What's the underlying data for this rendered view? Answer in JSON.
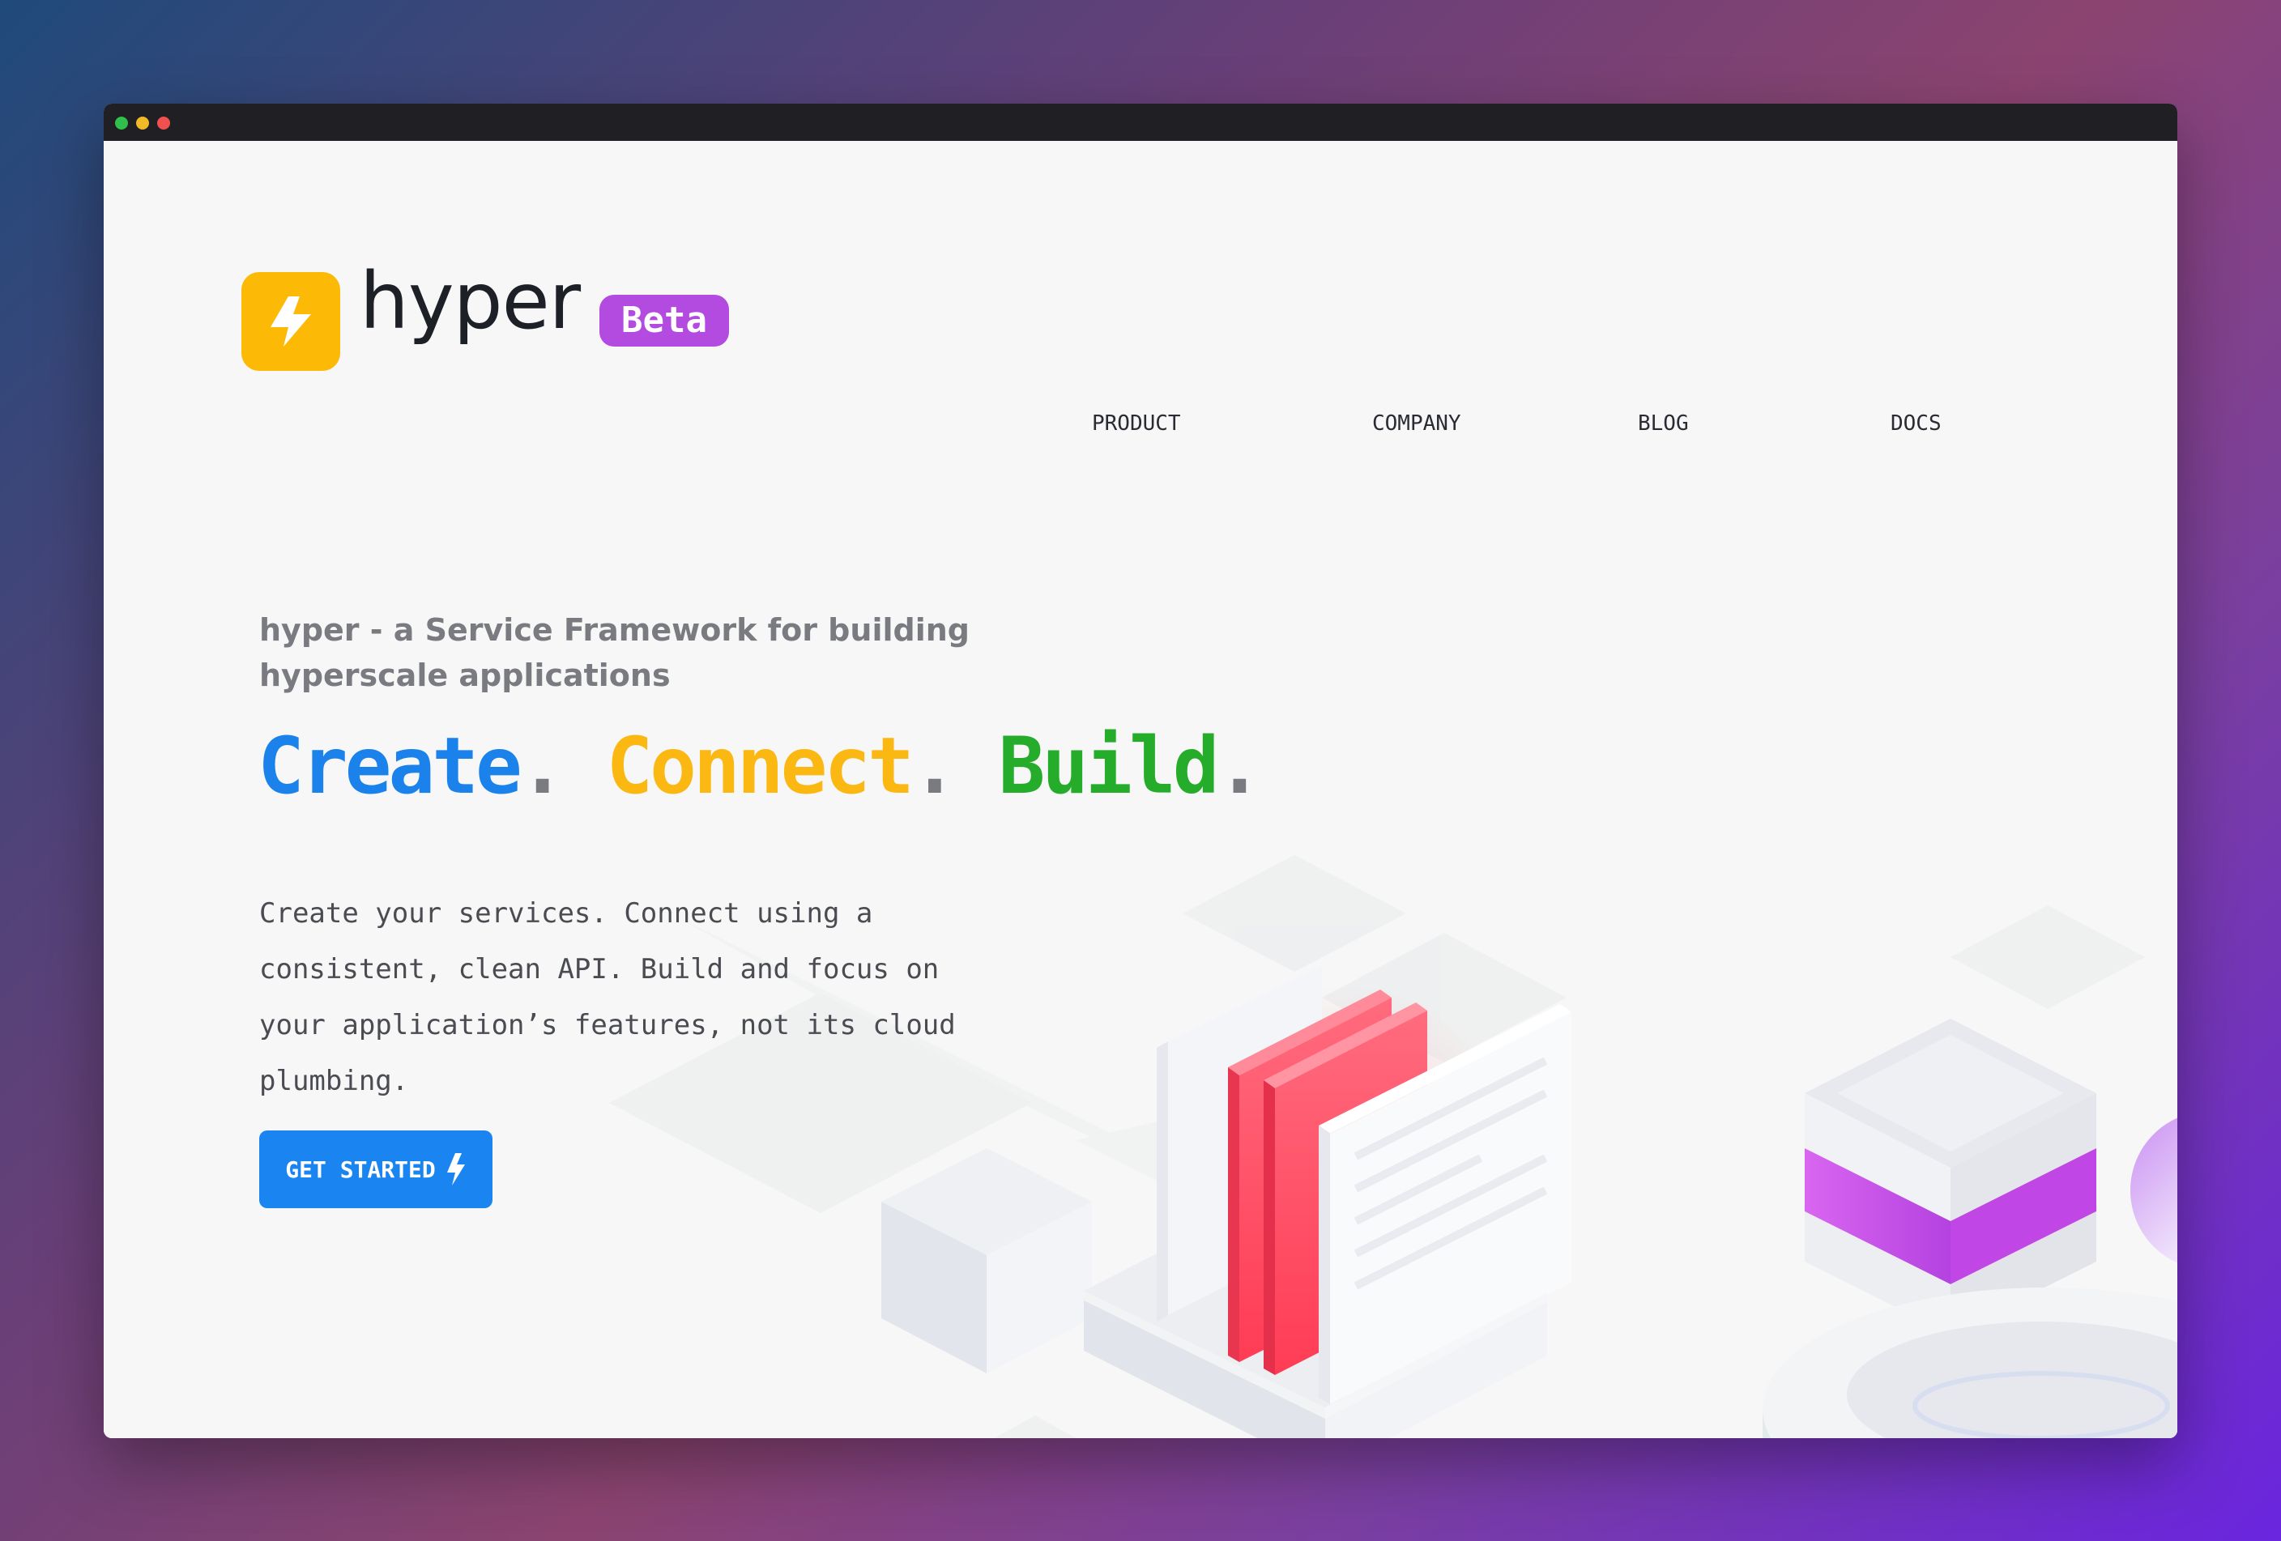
{
  "brand": {
    "name": "hyper",
    "badge": "Beta",
    "logo_icon": "lightning-bolt-icon",
    "logo_color": "#fcba06",
    "badge_color": "#b44be0"
  },
  "nav": {
    "items": [
      {
        "label": "PRODUCT"
      },
      {
        "label": "COMPANY"
      },
      {
        "label": "BLOG"
      },
      {
        "label": "DOCS"
      }
    ]
  },
  "hero": {
    "subtitle": "hyper - a Service Framework for building hyperscale applications",
    "headline": [
      {
        "word": "Create",
        "color": "#1a82ea"
      },
      {
        "word": "Connect",
        "color": "#fbb812"
      },
      {
        "word": "Build",
        "color": "#24ac2a"
      }
    ],
    "separator": ".",
    "body": "Create your services. Connect using a consistent, clean API. Build and focus on your application’s features, not its cloud plumbing.",
    "cta_label": "GET STARTED",
    "cta_icon": "lightning-bolt-icon",
    "cta_color": "#1a84f0"
  }
}
